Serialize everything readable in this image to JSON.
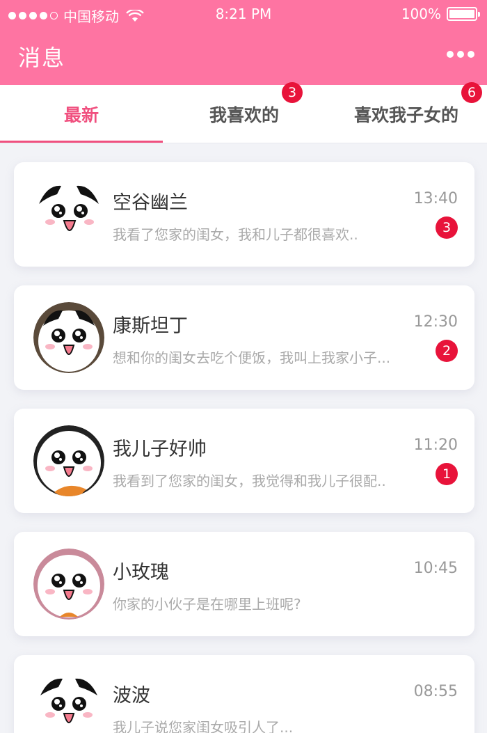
{
  "status_bar": {
    "carrier": "中国移动",
    "time": "8:21 PM",
    "battery": "100%"
  },
  "nav": {
    "title": "消息"
  },
  "tabs": [
    {
      "label": "最新",
      "badge": ""
    },
    {
      "label": "我喜欢的",
      "badge": "3"
    },
    {
      "label": "喜欢我子女的",
      "badge": "6"
    }
  ],
  "messages": [
    {
      "name": "空谷幽兰",
      "time": "13:40",
      "preview": "我看了您家的闺女，我和儿子都很喜欢..",
      "unread": "3"
    },
    {
      "name": "康斯坦丁",
      "time": "12:30",
      "preview": "想和你的闺女去吃个便饭，我叫上我家小子...",
      "unread": "2"
    },
    {
      "name": "我儿子好帅",
      "time": "11:20",
      "preview": "我看到了您家的闺女，我觉得和我儿子很配..",
      "unread": "1"
    },
    {
      "name": "小玫瑰",
      "time": "10:45",
      "preview": "你家的小伙子是在哪里上班呢?",
      "unread": ""
    },
    {
      "name": "波波",
      "time": "08:55",
      "preview": "我儿子说您家闺女吸引人了...",
      "unread": ""
    }
  ],
  "colors": {
    "header": "#fe74a2",
    "accent": "#f0507f",
    "badge": "#e8133a"
  }
}
